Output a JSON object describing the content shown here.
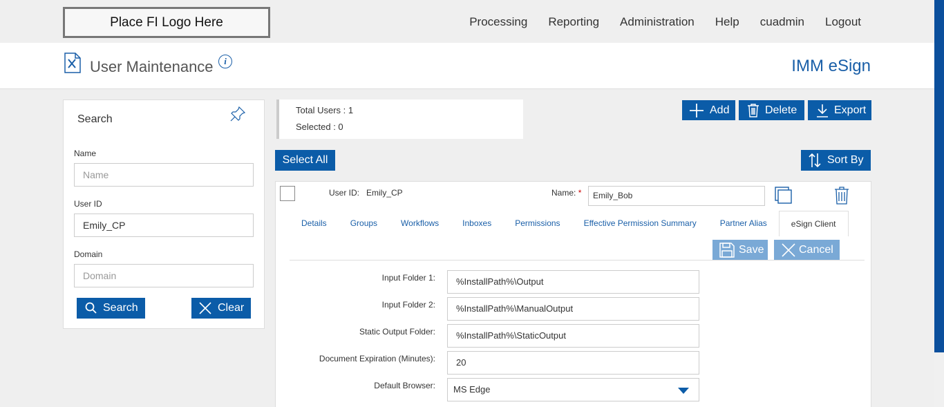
{
  "logo_text": "Place FI Logo Here",
  "nav": [
    "Processing",
    "Reporting",
    "Administration",
    "Help",
    "cuadmin",
    "Logout"
  ],
  "header": {
    "title": "User Maintenance",
    "brand": "IMM eSign",
    "info_icon": "info-icon"
  },
  "search": {
    "title": "Search",
    "name_label": "Name",
    "name_placeholder": "Name",
    "userid_label": "User ID",
    "userid_value": "Emily_CP",
    "domain_label": "Domain",
    "domain_placeholder": "Domain",
    "search_button": "Search",
    "clear_button": "Clear"
  },
  "counts": {
    "total": "Total Users : 1",
    "selected": "Selected : 0"
  },
  "toolbar": {
    "add": "Add",
    "delete": "Delete",
    "export": "Export",
    "select_all": "Select All",
    "sort_by": "Sort By"
  },
  "user": {
    "userid_label": "User ID:",
    "userid_value": "Emily_CP",
    "name_label": "Name:",
    "required_mark": "*",
    "name_value": "Emily_Bob"
  },
  "tabs": [
    "Details",
    "Groups",
    "Workflows",
    "Inboxes",
    "Permissions",
    "Effective Permission Summary",
    "Partner Alias",
    "eSign Client"
  ],
  "active_tab": "eSign Client",
  "form_actions": {
    "save": "Save",
    "cancel": "Cancel"
  },
  "esign_fields": [
    {
      "label": "Input Folder 1:",
      "value": "%InstallPath%\\Output"
    },
    {
      "label": "Input Folder 2:",
      "value": "%InstallPath%\\ManualOutput"
    },
    {
      "label": "Static Output Folder:",
      "value": "%InstallPath%\\StaticOutput"
    },
    {
      "label": "Document Expiration (Minutes):",
      "value": "20"
    },
    {
      "label": "Default Browser:",
      "value": "MS Edge"
    }
  ],
  "colors": {
    "primary": "#0b5ca8",
    "brand": "#1a5fa8",
    "disabled_button": "#7aa9d6"
  }
}
